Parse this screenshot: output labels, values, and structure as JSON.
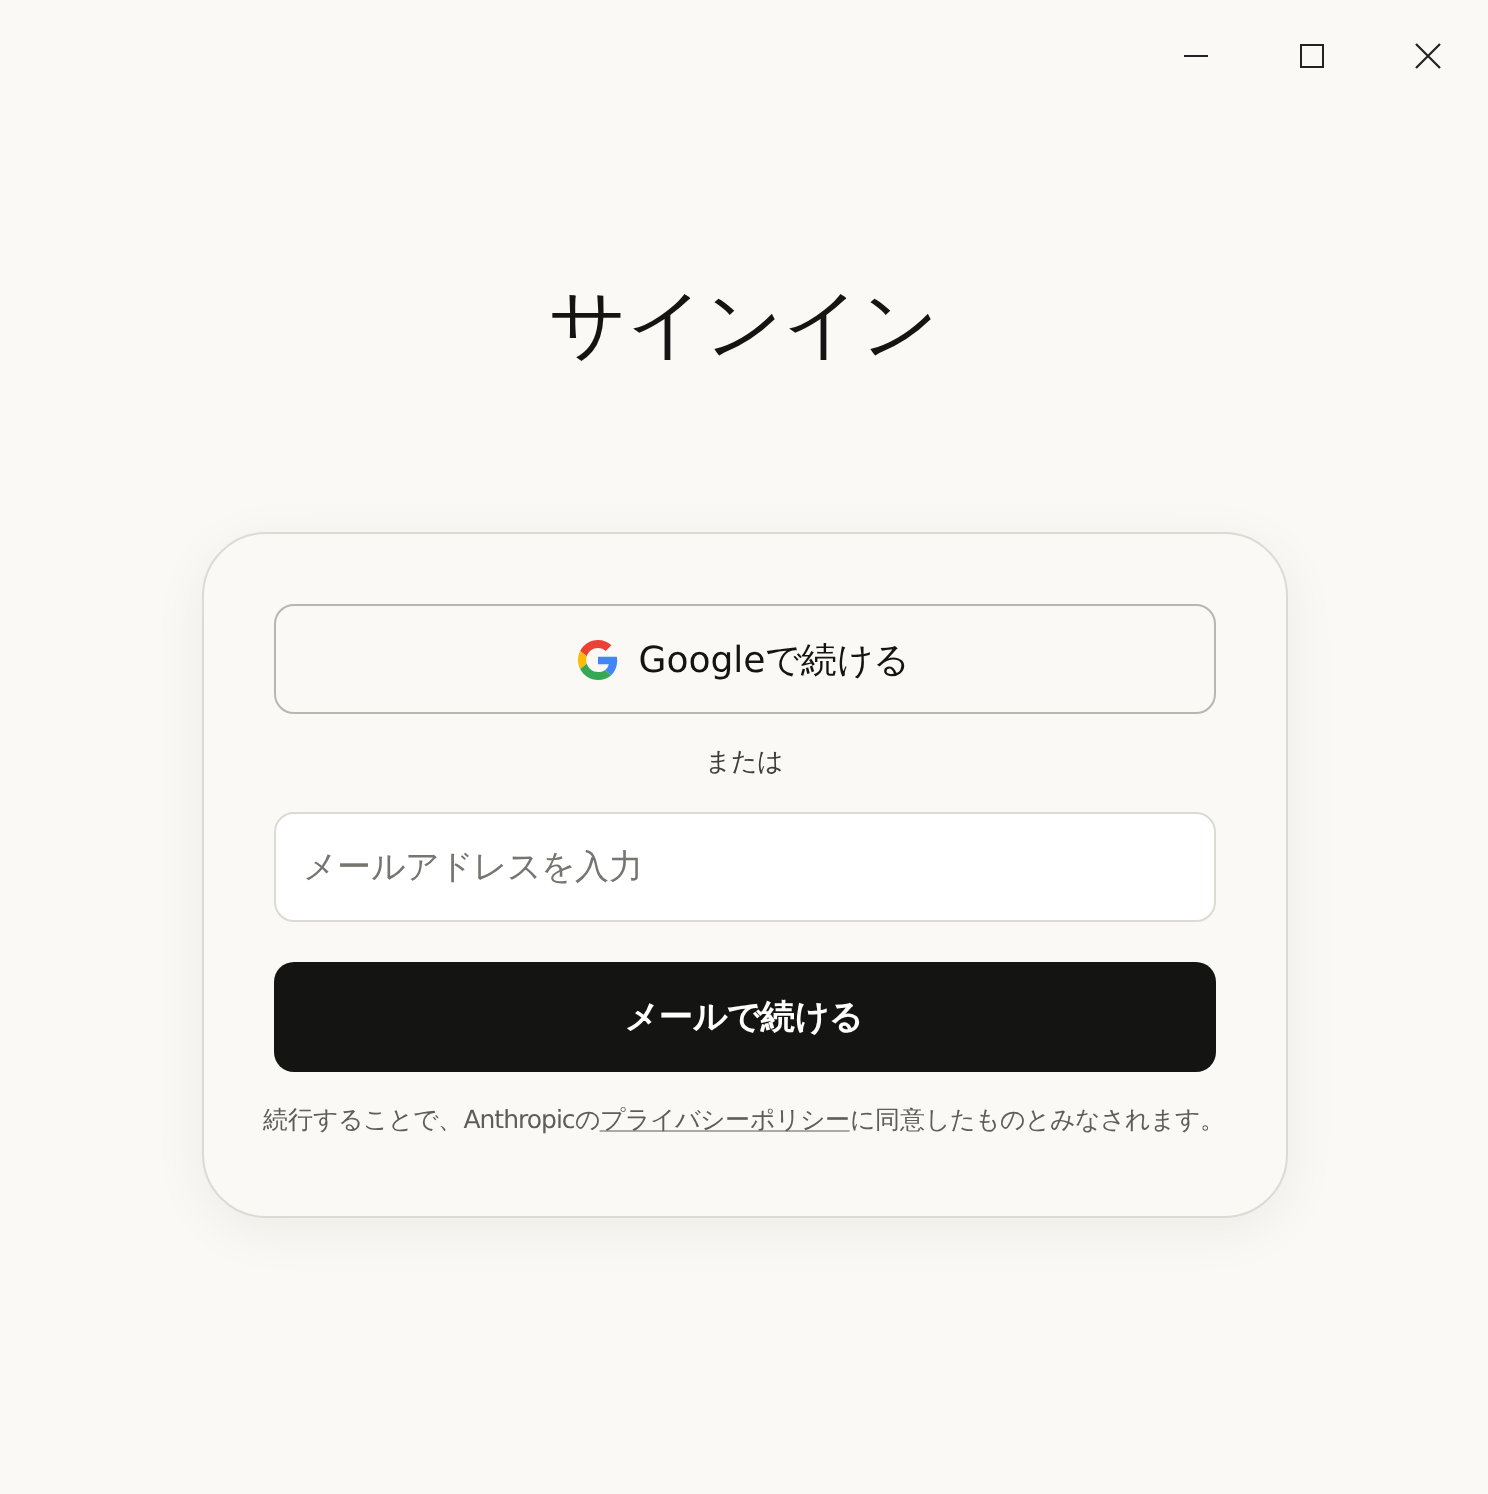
{
  "title": "サインイン",
  "google_button": {
    "label": "Googleで続ける"
  },
  "divider_text": "または",
  "email_field": {
    "placeholder": "メールアドレスを入力"
  },
  "submit_button": {
    "label": "メールで続ける"
  },
  "terms": {
    "before": "続行することで、Anthropicの",
    "link": "プライバシーポリシー",
    "after": "に同意したものとみなされます。"
  }
}
